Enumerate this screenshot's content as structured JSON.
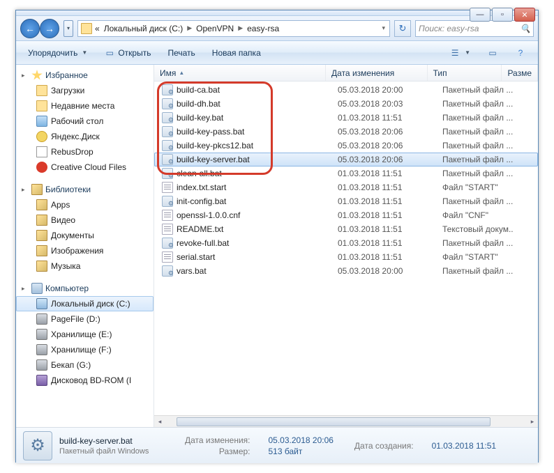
{
  "breadcrumb": {
    "glyph": "«",
    "seg1": "Локальный диск (C:)",
    "seg2": "OpenVPN",
    "seg3": "easy-rsa"
  },
  "search": {
    "placeholder": "Поиск: easy-rsa"
  },
  "toolbar": {
    "organize": "Упорядочить",
    "open": "Открыть",
    "print": "Печать",
    "newfolder": "Новая папка"
  },
  "columns": {
    "name": "Имя",
    "date": "Дата изменения",
    "type": "Тип",
    "size": "Разме"
  },
  "tree": {
    "fav": "Избранное",
    "fav_items": {
      "downloads": "Загрузки",
      "recent": "Недавние места",
      "desktop": "Рабочий стол",
      "yadisk": "Яндекс.Диск",
      "rebus": "RebusDrop",
      "cc": "Creative Cloud Files"
    },
    "lib": "Библиотеки",
    "lib_items": {
      "apps": "Apps",
      "video": "Видео",
      "docs": "Документы",
      "pics": "Изображения",
      "music": "Музыка"
    },
    "pc": "Компьютер",
    "pc_items": {
      "c": "Локальный диск (C:)",
      "d": "PageFile (D:)",
      "e": "Хранилище (E:)",
      "f": "Хранилище (F:)",
      "g": "Бекап (G:)",
      "bd": "Дисковод BD-ROM (I"
    }
  },
  "files": [
    {
      "name": "build-ca.bat",
      "date": "05.03.2018 20:00",
      "type": "Пакетный файл ...",
      "icon": "bat"
    },
    {
      "name": "build-dh.bat",
      "date": "05.03.2018 20:03",
      "type": "Пакетный файл ...",
      "icon": "bat"
    },
    {
      "name": "build-key.bat",
      "date": "01.03.2018 11:51",
      "type": "Пакетный файл ...",
      "icon": "bat"
    },
    {
      "name": "build-key-pass.bat",
      "date": "05.03.2018 20:06",
      "type": "Пакетный файл ...",
      "icon": "bat"
    },
    {
      "name": "build-key-pkcs12.bat",
      "date": "05.03.2018 20:06",
      "type": "Пакетный файл ...",
      "icon": "bat"
    },
    {
      "name": "build-key-server.bat",
      "date": "05.03.2018 20:06",
      "type": "Пакетный файл ...",
      "icon": "bat",
      "selected": true
    },
    {
      "name": "clean-all.bat",
      "date": "01.03.2018 11:51",
      "type": "Пакетный файл ...",
      "icon": "bat"
    },
    {
      "name": "index.txt.start",
      "date": "01.03.2018 11:51",
      "type": "Файл \"START\"",
      "icon": "txt"
    },
    {
      "name": "init-config.bat",
      "date": "01.03.2018 11:51",
      "type": "Пакетный файл ...",
      "icon": "bat"
    },
    {
      "name": "openssl-1.0.0.cnf",
      "date": "01.03.2018 11:51",
      "type": "Файл \"CNF\"",
      "icon": "txt"
    },
    {
      "name": "README.txt",
      "date": "01.03.2018 11:51",
      "type": "Текстовый докум...",
      "icon": "txt"
    },
    {
      "name": "revoke-full.bat",
      "date": "01.03.2018 11:51",
      "type": "Пакетный файл ...",
      "icon": "bat"
    },
    {
      "name": "serial.start",
      "date": "01.03.2018 11:51",
      "type": "Файл \"START\"",
      "icon": "txt"
    },
    {
      "name": "vars.bat",
      "date": "05.03.2018 20:00",
      "type": "Пакетный файл ...",
      "icon": "bat"
    }
  ],
  "details": {
    "name": "build-key-server.bat",
    "sub": "Пакетный файл Windows",
    "mod_lab": "Дата изменения:",
    "mod_val": "05.03.2018 20:06",
    "size_lab": "Размер:",
    "size_val": "513 байт",
    "cre_lab": "Дата создания:",
    "cre_val": "01.03.2018 11:51"
  }
}
